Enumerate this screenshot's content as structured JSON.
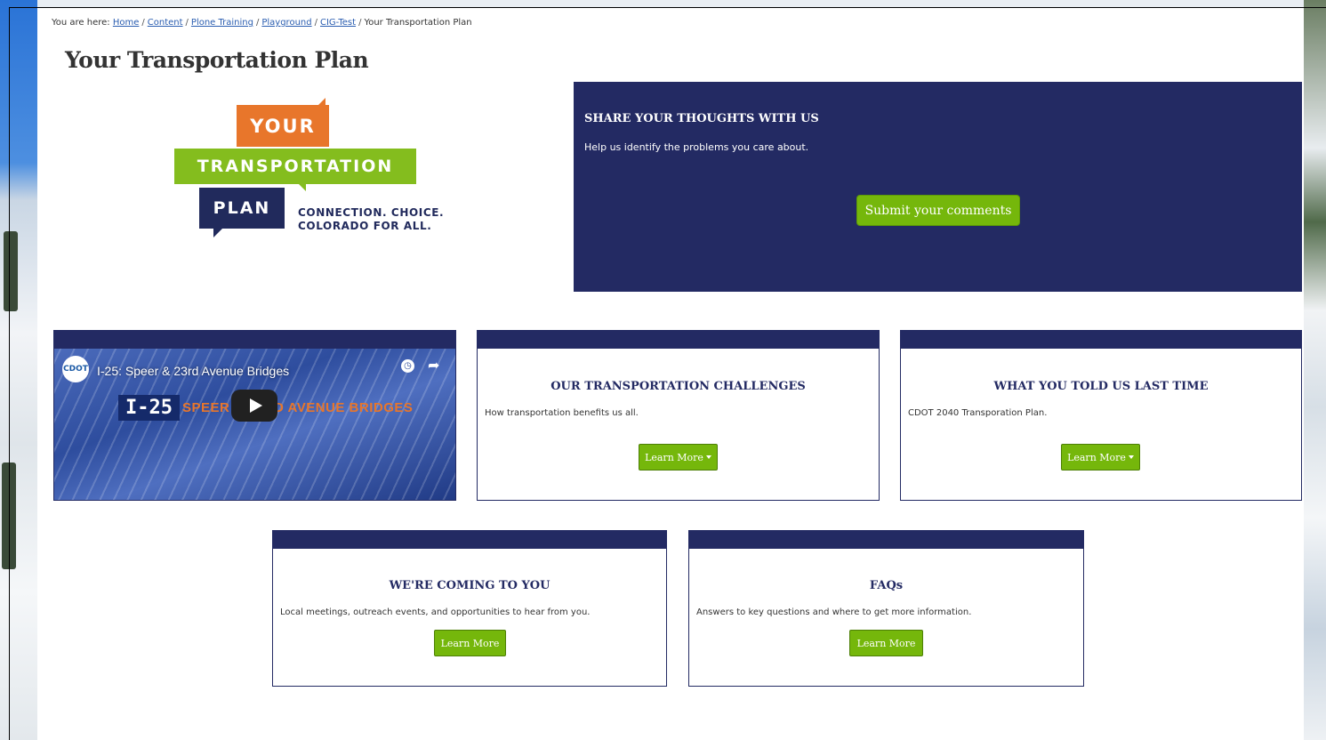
{
  "breadcrumb": {
    "prefix": "You are here:",
    "items": [
      "Home",
      "Content",
      "Plone Training",
      "Playground",
      "CIG-Test"
    ],
    "current": "Your Transportation Plan"
  },
  "page_title": "Your Transportation Plan",
  "logo": {
    "word1": "YOUR",
    "word2": "TRANSPORTATION",
    "word3": "PLAN",
    "tagline1": "CONNECTION. CHOICE.",
    "tagline2": "COLORADO FOR ALL."
  },
  "share": {
    "title": "SHARE YOUR THOUGHTS WITH US",
    "text": "Help us identify the problems you care about.",
    "button": "Submit your comments"
  },
  "video": {
    "title": "I-25: Speer & 23rd Avenue Bridges",
    "overlay_main": "I-25",
    "overlay_sub": "SPEER & 23RD AVENUE BRIDGES",
    "channel_logo": "CDOT"
  },
  "cards": [
    {
      "title": "OUR TRANSPORTATION CHALLENGES",
      "text": "How transportation benefits us all.",
      "button": "Learn More",
      "dropdown": true
    },
    {
      "title": "WHAT YOU TOLD US LAST TIME",
      "text": "CDOT 2040 Transporation Plan.",
      "button": "Learn More",
      "dropdown": true
    },
    {
      "title": "WE'RE COMING TO YOU",
      "text": "Local meetings, outreach events, and opportunities to hear from you.",
      "button": "Learn More",
      "dropdown": false
    },
    {
      "title": "FAQs",
      "text": "Answers to key questions and where to get more information.",
      "button": "Learn More",
      "dropdown": false
    }
  ],
  "colors": {
    "navy": "#232a63",
    "green": "#75b70b",
    "orange": "#e8762b",
    "logo_green": "#84bd1e"
  }
}
